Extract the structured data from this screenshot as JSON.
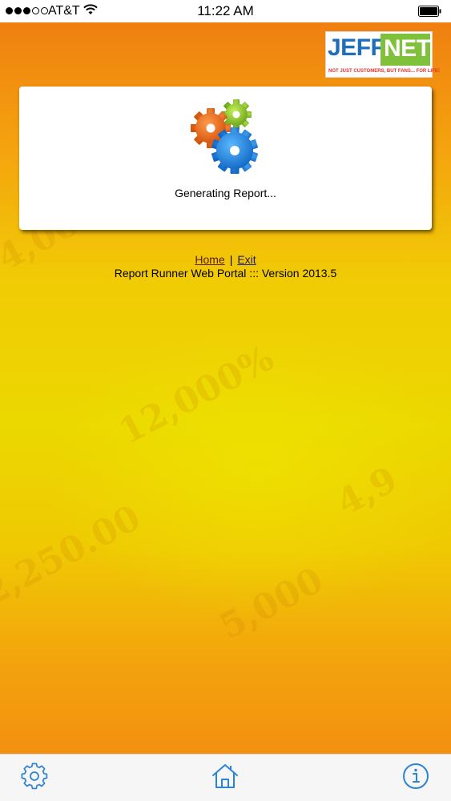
{
  "status_bar": {
    "carrier": "AT&T",
    "time": "11:22 AM",
    "signal_bars_filled": 3,
    "signal_bars_total": 5
  },
  "logo": {
    "part1": "JEFF",
    "part2": "NET",
    "tagline": "NOT JUST CUSTOMERS, BUT FANS... FOR LIFE!"
  },
  "report": {
    "status": "Generating Report...",
    "icon": "gears-icon"
  },
  "links": {
    "home": "Home",
    "separator": "|",
    "exit": "Exit"
  },
  "footer": {
    "version": "Report Runner Web Portal ::: Version 2013.5"
  },
  "toolbar": {
    "icons": [
      "gear-icon",
      "home-icon",
      "info-icon"
    ]
  },
  "colors": {
    "accent": "#2b83d6",
    "bg_orange": "#f07f10",
    "bg_yellow": "#ebd800"
  }
}
